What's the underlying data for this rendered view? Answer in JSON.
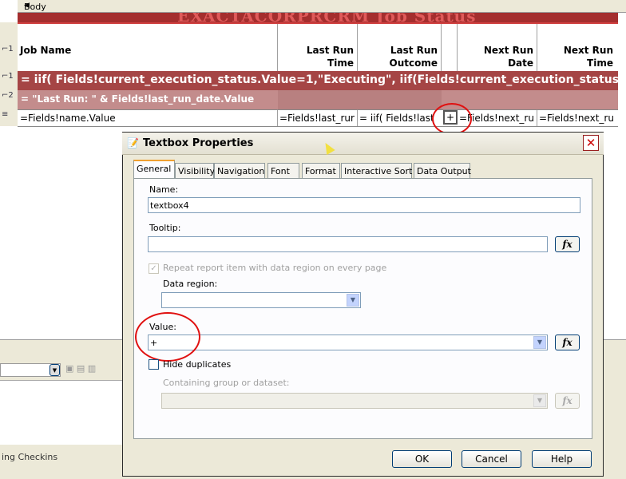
{
  "designer": {
    "body_tab_label": "Body",
    "title_text": "EXACTACORPRCRM Job Status",
    "headers": {
      "job_name": "Job Name",
      "last_run_time": [
        "Last Run",
        "Time"
      ],
      "last_run_outcome": [
        "Last Run",
        "Outcome"
      ],
      "next_run_date": [
        "Next Run",
        "Date"
      ],
      "next_run_time": [
        "Next Run",
        "Time"
      ]
    },
    "exec_expression": "= iif(  Fields!current_execution_status.Value=1,\"Executing\", iif(Fields!current_execution_status",
    "lastrun_expression": "= \"Last Run: \" &  Fields!last_run_date.Value",
    "detail": {
      "name": "=Fields!name.Value",
      "last_run_time": "=Fields!last_rur",
      "last_run_outcome": "= iif(  Fields!last",
      "plus": "+",
      "next_run_date": "=Fields!next_ru",
      "next_run_time": "=Fields!next_ru"
    },
    "row_markers": [
      "⌐1",
      "⌐2",
      "≡"
    ]
  },
  "lower_pane": {
    "status_text": "ing Checkins"
  },
  "dialog": {
    "title": "Textbox Properties",
    "close_label": "✕",
    "tabs": [
      "General",
      "Visibility",
      "Navigation",
      "Font",
      "Format",
      "Interactive Sort",
      "Data Output"
    ],
    "active_tab": "General",
    "name_label": "Name:",
    "name_value": "textbox4",
    "tooltip_label": "Tooltip:",
    "tooltip_value": "",
    "repeat_label": "Repeat report item with data region on every page",
    "data_region_label": "Data region:",
    "data_region_value": "",
    "value_label": "Value:",
    "value_value": "+",
    "hide_duplicates_label": "Hide duplicates",
    "containing_group_label": "Containing group or dataset:",
    "containing_group_value": "",
    "fx_label": "fx",
    "ok_label": "OK",
    "cancel_label": "Cancel",
    "help_label": "Help"
  },
  "colors": {
    "exec_row": "#a54545",
    "lastrun_row": "#c38c8c",
    "annotation_circle": "#e01010",
    "active_tab_accent": "#f0a030"
  }
}
